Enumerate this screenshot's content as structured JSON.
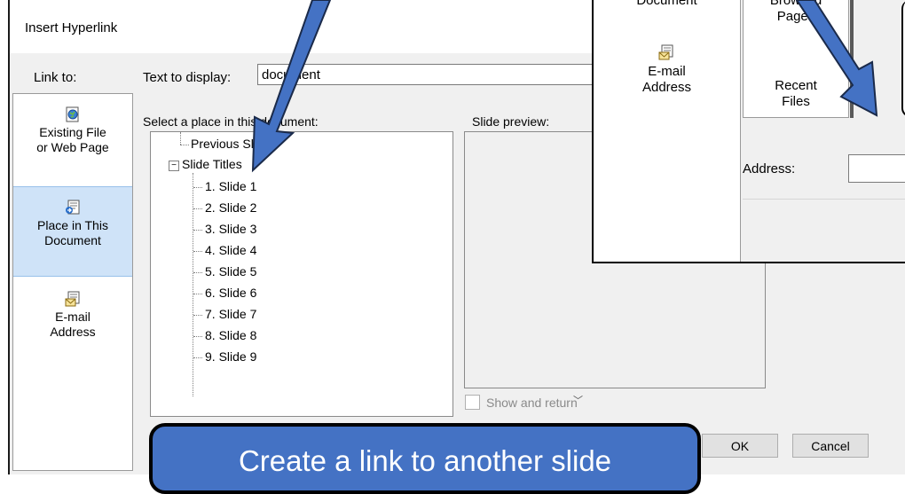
{
  "dialog": {
    "title": "Insert Hyperlink",
    "link_to_label": "Link to:",
    "link_options": [
      {
        "label1": "Existing File",
        "label2": "or Web Page",
        "icon": "globe-file-icon"
      },
      {
        "label1": "Place in This",
        "label2": "Document",
        "icon": "document-place-icon"
      },
      {
        "label1": "E-mail",
        "label2": "Address",
        "icon": "email-icon"
      }
    ],
    "text_to_display_label": "Text to display:",
    "text_to_display_value": "document",
    "place_label": "Select a place in this document:",
    "preview_label": "Slide preview:",
    "tree": {
      "previous": "Previous Slide",
      "group": "Slide Titles",
      "slides": [
        "1. Slide 1",
        "2. Slide 2",
        "3. Slide 3",
        "4. Slide 4",
        "5. Slide 5",
        "6. Slide 6",
        "7. Slide 7",
        "8. Slide 8",
        "9. Slide 9"
      ]
    },
    "show_and_return": "Show and return",
    "ok": "OK",
    "cancel": "Cancel"
  },
  "callout": {
    "text": "Create a link to another slide"
  },
  "inset": {
    "document_label": "Document",
    "email_label1": "E-mail",
    "email_label2": "Address",
    "browsed_label1": "Browsed",
    "browsed_label2": "Pages",
    "recent_label1": "Recent",
    "recent_label2": "Files",
    "address_label": "Address:"
  },
  "colors": {
    "accent": "#4472c4",
    "selection": "#cfe3f8"
  }
}
